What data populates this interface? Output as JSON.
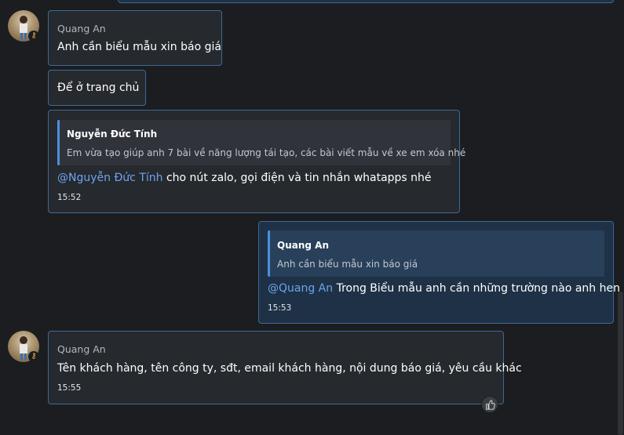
{
  "messages": [
    {
      "sender": "Quang An",
      "text": "Anh cần biểu mẫu xin báo giá"
    },
    {
      "text": "Để ở trang chủ"
    },
    {
      "quote_author": "Nguyễn Đức Tính",
      "quote_text": "Em vừa tạo giúp anh 7 bài về năng lượng tái tạo, các bài viết mẫu về xe em xóa nhé",
      "mention": "@Nguyễn Đức Tính",
      "text": " cho nút zalo, gọi điện và tin nhắn whatapps nhé",
      "time": "15:52"
    },
    {
      "quote_author": "Quang An",
      "quote_text": "Anh cần biểu mẫu xin báo giá",
      "mention": "@Quang An",
      "text": " Trong Biểu mẫu anh cần những trường nào anh hen",
      "time": "15:53"
    },
    {
      "sender": "Quang An",
      "text": "Tên khách hàng, tên công ty, sđt, email khách hàng, nội dung báo giá, yêu cầu khác",
      "time": "15:55"
    }
  ],
  "icons": {
    "key_badge": "key-icon",
    "like": "thumbs-up-icon"
  }
}
